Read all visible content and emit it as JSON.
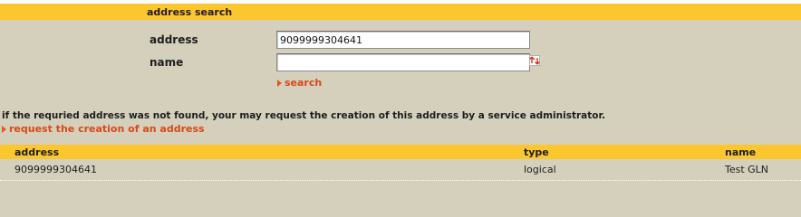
{
  "section": {
    "title": "address search"
  },
  "form": {
    "address_label": "address",
    "address_value": "9099999304641",
    "name_label": "name",
    "name_value": "",
    "search_link": "search"
  },
  "info": {
    "message": "if the requried address was not found, your may request the creation of this address by a service administrator.",
    "request_link": "request the creation of an address"
  },
  "table": {
    "columns": [
      "address",
      "type",
      "name"
    ],
    "rows": [
      {
        "address": "9099999304641",
        "type": "logical",
        "name": "Test GLN"
      }
    ]
  },
  "colors": {
    "header_bg": "#fcc62f",
    "page_bg": "#d4d0bc",
    "link": "#d9481a"
  },
  "icons": {
    "lookup": "lookup-icon",
    "arrow": "arrow-right-icon"
  }
}
